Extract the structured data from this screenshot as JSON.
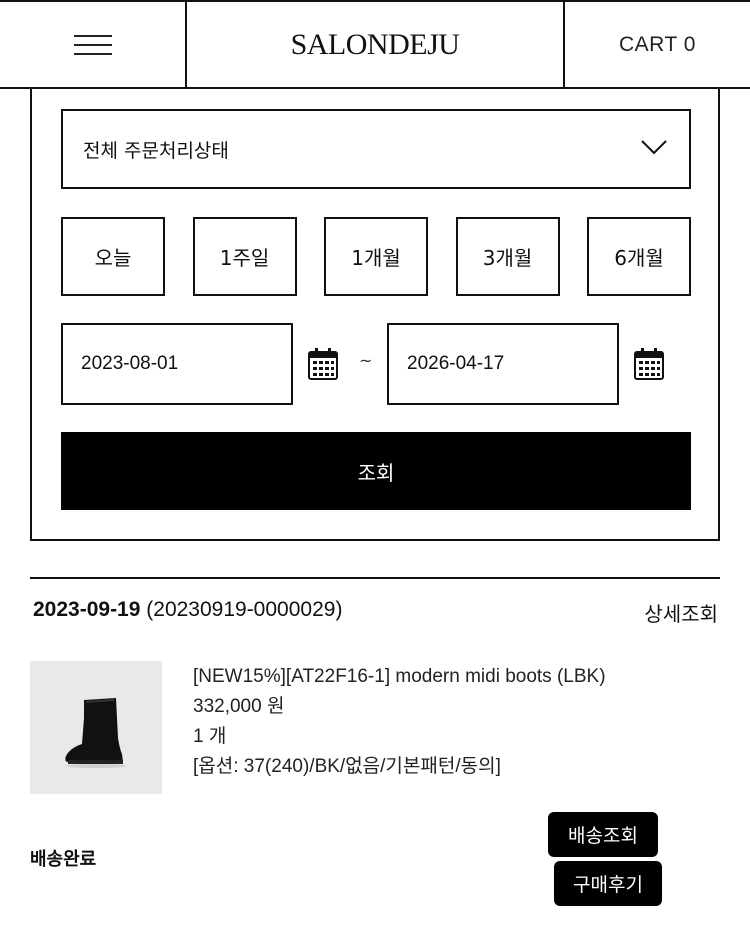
{
  "header": {
    "menu_icon": "hamburger-menu-icon",
    "logo": "SALONDEJU",
    "cart_label": "CART",
    "cart_count": "0"
  },
  "filter": {
    "status_select": "전체 주문처리상태",
    "periods": [
      "오늘",
      "1주일",
      "1개월",
      "3개월",
      "6개월"
    ],
    "date_from": "2023-08-01",
    "date_separator": "~",
    "date_to": "2026-04-17",
    "calendar_icon": "calendar-icon",
    "search_label": "조회"
  },
  "order": {
    "date": "2023-09-19",
    "number": "(20230919-0000029)",
    "detail_link": "상세조회",
    "product_name": "[NEW15%][AT22F16-1] modern midi boots (LBK)",
    "price": "332,000 원",
    "quantity": "1 개",
    "options": "[옵션: 37(240)/BK/없음/기본패턴/동의]",
    "status": "배송완료",
    "track_button": "배송조회",
    "review_button": "구매후기"
  }
}
